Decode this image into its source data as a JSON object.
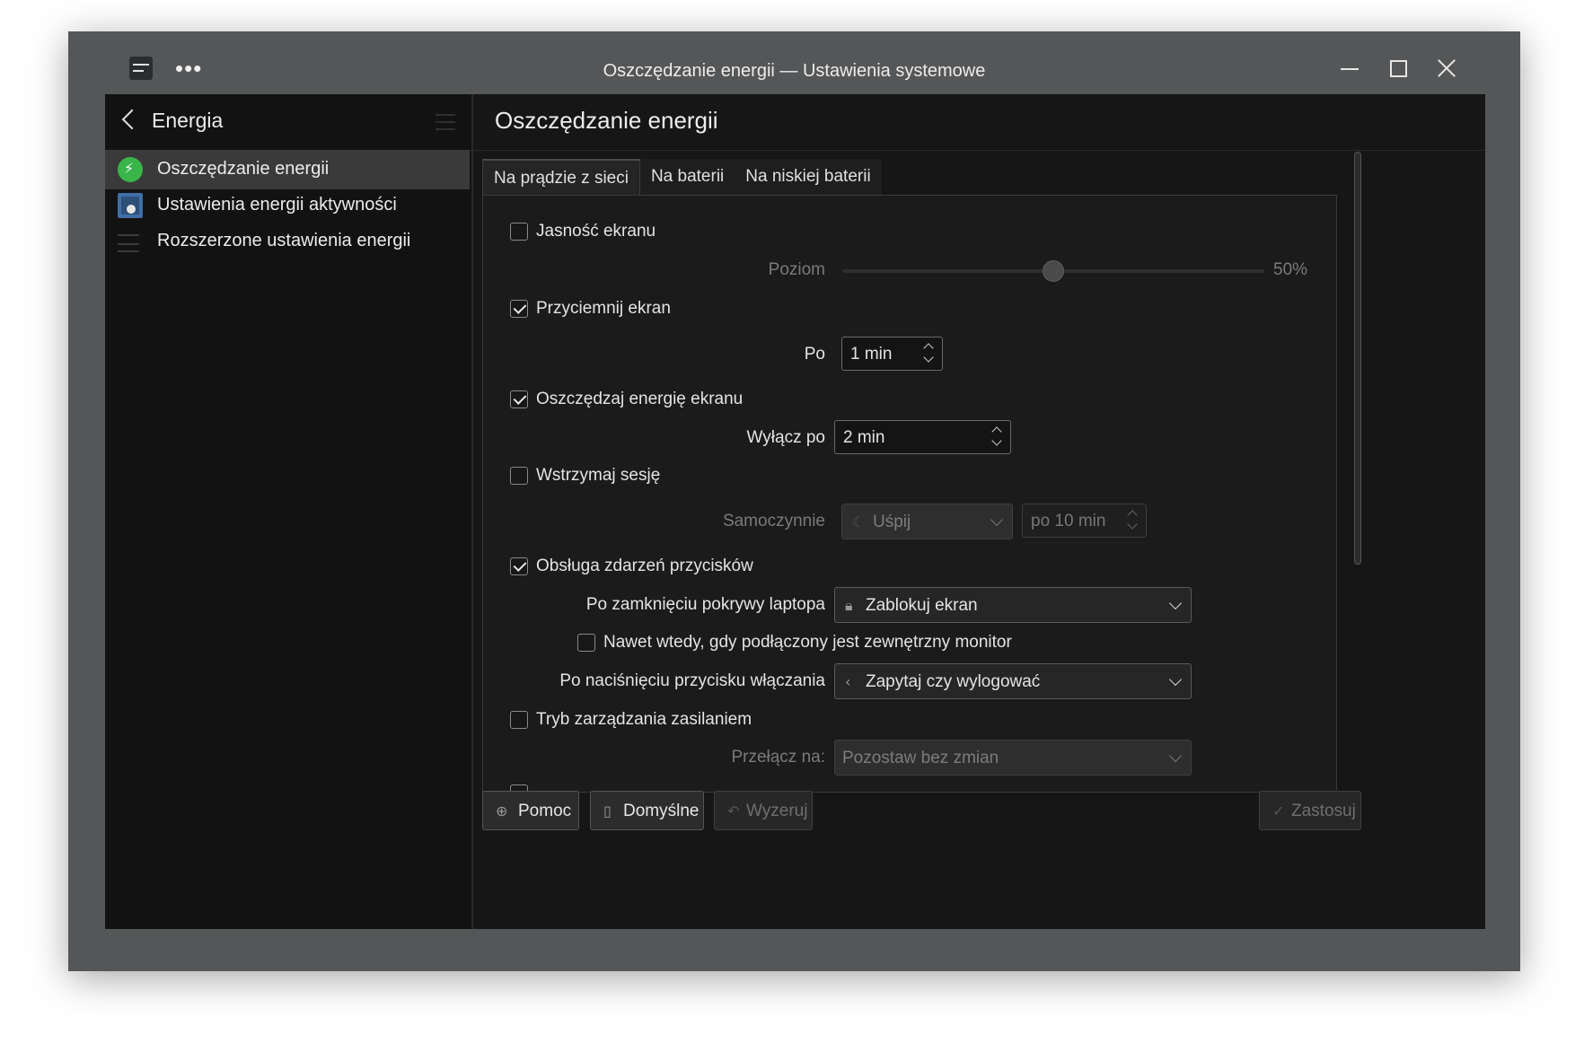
{
  "window": {
    "title": "Oszczędzanie energii — Ustawienia systemowe",
    "menu_dots": "•••"
  },
  "sidebar": {
    "title": "Energia",
    "items": [
      {
        "label": "Oszczędzanie energii",
        "icon": "power-saving-icon",
        "active": true
      },
      {
        "label": "Ustawienia energii aktywności",
        "icon": "activity-power-icon",
        "active": false
      },
      {
        "label": "Rozszerzone ustawienia energii",
        "icon": "advanced-list-icon",
        "active": false
      }
    ]
  },
  "main": {
    "title": "Oszczędzanie energii",
    "tabs": [
      "Na prądzie z sieci",
      "Na baterii",
      "Na niskiej baterii"
    ],
    "active_tab": 0,
    "settings": {
      "brightness": {
        "label": "Jasność ekranu",
        "checked": false,
        "level_label": "Poziom",
        "level_value": "50%",
        "level_fraction": 0.5
      },
      "dim": {
        "label": "Przyciemnij ekran",
        "checked": true,
        "after_label": "Po",
        "after_value": "1 min"
      },
      "dpms": {
        "label": "Oszczędzaj energię ekranu",
        "checked": true,
        "off_label": "Wyłącz po",
        "off_value": "2 min"
      },
      "suspend": {
        "label": "Wstrzymaj sesję",
        "checked": false,
        "auto_label": "Samoczynnie",
        "auto_value": "Uśpij",
        "after_value": "po 10 min"
      },
      "buttons": {
        "label": "Obsługa zdarzeń przycisków",
        "checked": true,
        "lid_label": "Po zamknięciu pokrywy laptopa",
        "lid_value": "Zablokuj ekran",
        "monitor_label": "Nawet wtedy, gdy podłączony jest zewnętrzny monitor",
        "monitor_checked": false,
        "power_label": "Po naciśnięciu przycisku włączania",
        "power_value": "Zapytaj czy wylogować"
      },
      "profile": {
        "label": "Tryb zarządzania zasilaniem",
        "checked": false,
        "switch_label": "Przełącz na:",
        "switch_value": "Pozostaw bez zmian"
      }
    }
  },
  "footer": {
    "help": "Pomoc",
    "defaults": "Domyślne",
    "reset": "Wyzeruj",
    "apply": "Zastosuj"
  }
}
